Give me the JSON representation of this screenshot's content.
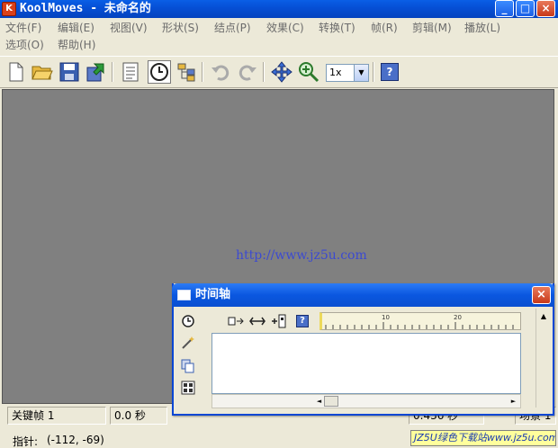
{
  "window": {
    "title": "KoolMoves - 未命名的",
    "app_icon_letter": "K",
    "minimize": "_",
    "maximize": "□",
    "close": "×"
  },
  "menu": {
    "row1": [
      "文件(F)",
      "编辑(E)",
      "视图(V)",
      "形状(S)",
      "结点(P)",
      "效果(C)",
      "转换(T)",
      "帧(R)",
      "剪辑(M)",
      "播放(L)"
    ],
    "row2": [
      "选项(O)",
      "帮助(H)"
    ]
  },
  "toolbar": {
    "icons": [
      "new-file-icon",
      "open-folder-icon",
      "save-icon",
      "import-icon",
      "properties-icon",
      "timeline-clock-icon",
      "layout-icon",
      "undo-icon",
      "redo-icon",
      "move-icon",
      "zoom-icon"
    ],
    "zoom_value": "1x",
    "help": "?"
  },
  "canvas": {
    "watermark_url": "http://www.jz5u.com",
    "background": "#808080"
  },
  "timeline": {
    "title": "时间轴",
    "close": "×",
    "ruler_labels": [
      "10",
      "20"
    ],
    "help": "?"
  },
  "status": {
    "keyframe": "关键帧 1",
    "time": "0.0 秒",
    "duration": "0.436 秒",
    "scene": "场景 1",
    "pointer_label": "指针:",
    "pointer_coords": "(-112, -69)",
    "watermark_badge": "JZ5U绿色下载站www.jz5u.com"
  },
  "colors": {
    "title_bar": "#0a57e0",
    "window_bg": "#ece9d8",
    "canvas": "#808080",
    "close_button": "#d2491f"
  }
}
